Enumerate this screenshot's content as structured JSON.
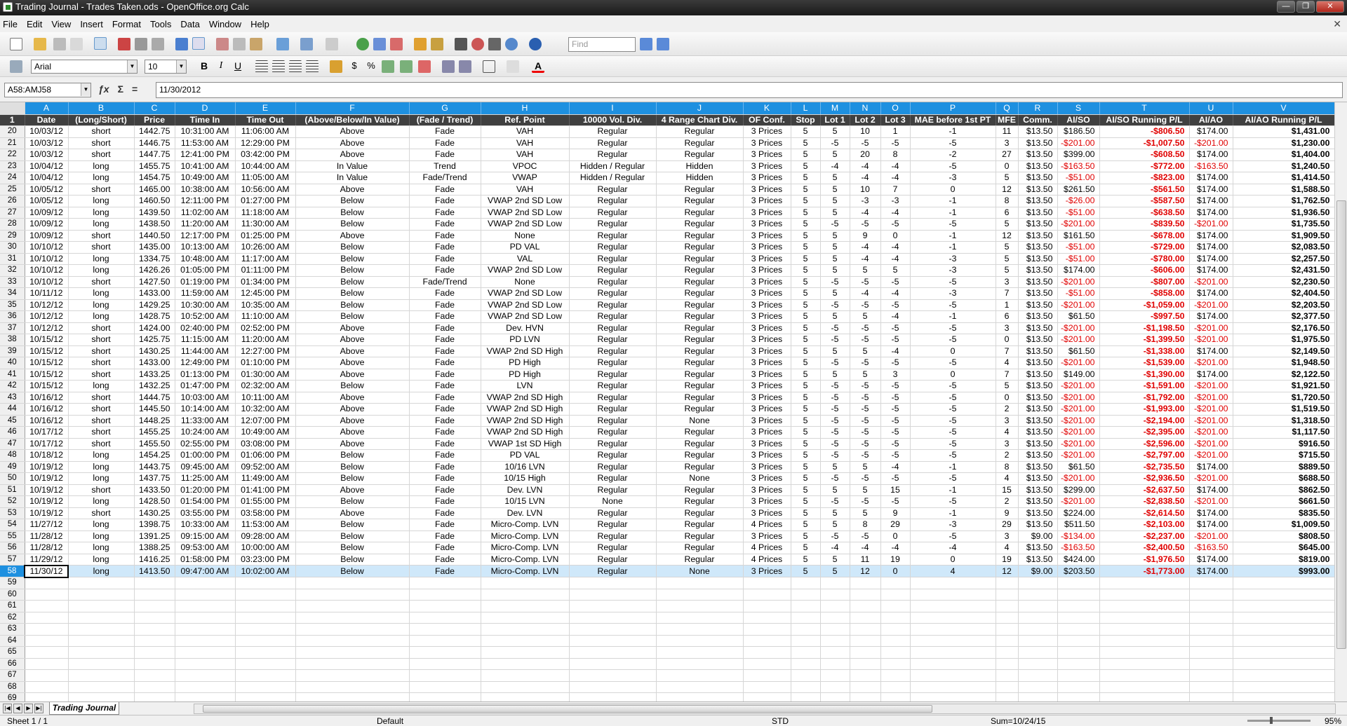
{
  "window": {
    "title": "Trading Journal - Trades Taken.ods - OpenOffice.org Calc"
  },
  "menu": [
    "File",
    "Edit",
    "View",
    "Insert",
    "Format",
    "Tools",
    "Data",
    "Window",
    "Help"
  ],
  "toolbar": {
    "font_name": "Arial",
    "font_size": "10",
    "find_placeholder": "Find"
  },
  "formula_bar": {
    "name_box": "A58:AMJ58",
    "content": "11/30/2012"
  },
  "columns": [
    "A",
    "B",
    "C",
    "D",
    "E",
    "F",
    "G",
    "H",
    "I",
    "J",
    "K",
    "L",
    "M",
    "N",
    "O",
    "P",
    "Q",
    "R",
    "S",
    "T",
    "U",
    "V"
  ],
  "headers": [
    "Date",
    "(Long/Short)",
    "Price",
    "Time In",
    "Time Out",
    "(Above/Below/In Value)",
    "(Fade / Trend)",
    "Ref. Point",
    "10000 Vol. Div.",
    "4 Range Chart Div.",
    "OF Conf.",
    "Stop",
    "Lot 1",
    "Lot 2",
    "Lot 3",
    "MAE before 1st PT",
    "MFE",
    "Comm.",
    "AI/SO",
    "AI/SO Running P/L",
    "AI/AO",
    "AI/AO Running P/L"
  ],
  "rows": [
    [
      "20",
      "10/03/12",
      "short",
      "1442.75",
      "10:31:00 AM",
      "11:06:00 AM",
      "Above",
      "Fade",
      "VAH",
      "Regular",
      "Regular",
      "3 Prices",
      "5",
      "5",
      "10",
      "1",
      "-1",
      "11",
      "$13.50",
      "$186.50",
      "-$806.50",
      "$174.00",
      "$1,431.00"
    ],
    [
      "21",
      "10/03/12",
      "short",
      "1446.75",
      "11:53:00 AM",
      "12:29:00 PM",
      "Above",
      "Fade",
      "VAH",
      "Regular",
      "Regular",
      "3 Prices",
      "5",
      "-5",
      "-5",
      "-5",
      "-5",
      "3",
      "$13.50",
      "-$201.00",
      "-$1,007.50",
      "-$201.00",
      "$1,230.00"
    ],
    [
      "22",
      "10/03/12",
      "short",
      "1447.75",
      "12:41:00 PM",
      "03:42:00 PM",
      "Above",
      "Fade",
      "VAH",
      "Regular",
      "Regular",
      "3 Prices",
      "5",
      "5",
      "20",
      "8",
      "-2",
      "27",
      "$13.50",
      "$399.00",
      "-$608.50",
      "$174.00",
      "$1,404.00"
    ],
    [
      "23",
      "10/04/12",
      "long",
      "1455.75",
      "10:41:00 AM",
      "10:44:00 AM",
      "In Value",
      "Trend",
      "VPOC",
      "Hidden / Regular",
      "Hidden",
      "3 Prices",
      "5",
      "-4",
      "-4",
      "-4",
      "-5",
      "0",
      "$13.50",
      "-$163.50",
      "-$772.00",
      "-$163.50",
      "$1,240.50"
    ],
    [
      "24",
      "10/04/12",
      "long",
      "1454.75",
      "10:49:00 AM",
      "11:05:00 AM",
      "In Value",
      "Fade/Trend",
      "VWAP",
      "Hidden / Regular",
      "Hidden",
      "3 Prices",
      "5",
      "5",
      "-4",
      "-4",
      "-3",
      "5",
      "$13.50",
      "-$51.00",
      "-$823.00",
      "$174.00",
      "$1,414.50"
    ],
    [
      "25",
      "10/05/12",
      "short",
      "1465.00",
      "10:38:00 AM",
      "10:56:00 AM",
      "Above",
      "Fade",
      "VAH",
      "Regular",
      "Regular",
      "3 Prices",
      "5",
      "5",
      "10",
      "7",
      "0",
      "12",
      "$13.50",
      "$261.50",
      "-$561.50",
      "$174.00",
      "$1,588.50"
    ],
    [
      "26",
      "10/05/12",
      "long",
      "1460.50",
      "12:11:00 PM",
      "01:27:00 PM",
      "Below",
      "Fade",
      "VWAP 2nd SD Low",
      "Regular",
      "Regular",
      "3 Prices",
      "5",
      "5",
      "-3",
      "-3",
      "-1",
      "8",
      "$13.50",
      "-$26.00",
      "-$587.50",
      "$174.00",
      "$1,762.50"
    ],
    [
      "27",
      "10/09/12",
      "long",
      "1439.50",
      "11:02:00 AM",
      "11:18:00 AM",
      "Below",
      "Fade",
      "VWAP 2nd SD Low",
      "Regular",
      "Regular",
      "3 Prices",
      "5",
      "5",
      "-4",
      "-4",
      "-1",
      "6",
      "$13.50",
      "-$51.00",
      "-$638.50",
      "$174.00",
      "$1,936.50"
    ],
    [
      "28",
      "10/09/12",
      "long",
      "1438.50",
      "11:20:00 AM",
      "11:30:00 AM",
      "Below",
      "Fade",
      "VWAP 2nd SD Low",
      "Regular",
      "Regular",
      "3 Prices",
      "5",
      "-5",
      "-5",
      "-5",
      "-5",
      "5",
      "$13.50",
      "-$201.00",
      "-$839.50",
      "-$201.00",
      "$1,735.50"
    ],
    [
      "29",
      "10/09/12",
      "short",
      "1440.50",
      "12:17:00 PM",
      "01:25:00 PM",
      "Above",
      "Fade",
      "None",
      "Regular",
      "Regular",
      "3 Prices",
      "5",
      "5",
      "9",
      "0",
      "-1",
      "12",
      "$13.50",
      "$161.50",
      "-$678.00",
      "$174.00",
      "$1,909.50"
    ],
    [
      "30",
      "10/10/12",
      "short",
      "1435.00",
      "10:13:00 AM",
      "10:26:00 AM",
      "Below",
      "Fade",
      "PD VAL",
      "Regular",
      "Regular",
      "3 Prices",
      "5",
      "5",
      "-4",
      "-4",
      "-1",
      "5",
      "$13.50",
      "-$51.00",
      "-$729.00",
      "$174.00",
      "$2,083.50"
    ],
    [
      "31",
      "10/10/12",
      "long",
      "1334.75",
      "10:48:00 AM",
      "11:17:00 AM",
      "Below",
      "Fade",
      "VAL",
      "Regular",
      "Regular",
      "3 Prices",
      "5",
      "5",
      "-4",
      "-4",
      "-3",
      "5",
      "$13.50",
      "-$51.00",
      "-$780.00",
      "$174.00",
      "$2,257.50"
    ],
    [
      "32",
      "10/10/12",
      "long",
      "1426.26",
      "01:05:00 PM",
      "01:11:00 PM",
      "Below",
      "Fade",
      "VWAP 2nd SD Low",
      "Regular",
      "Regular",
      "3 Prices",
      "5",
      "5",
      "5",
      "5",
      "-3",
      "5",
      "$13.50",
      "$174.00",
      "-$606.00",
      "$174.00",
      "$2,431.50"
    ],
    [
      "33",
      "10/10/12",
      "short",
      "1427.50",
      "01:19:00 PM",
      "01:34:00 PM",
      "Below",
      "Fade/Trend",
      "None",
      "Regular",
      "Regular",
      "3 Prices",
      "5",
      "-5",
      "-5",
      "-5",
      "-5",
      "3",
      "$13.50",
      "-$201.00",
      "-$807.00",
      "-$201.00",
      "$2,230.50"
    ],
    [
      "34",
      "10/11/12",
      "long",
      "1433.00",
      "11:59:00 AM",
      "12:45:00 PM",
      "Below",
      "Fade",
      "VWAP 2nd SD Low",
      "Regular",
      "Regular",
      "3 Prices",
      "5",
      "5",
      "-4",
      "-4",
      "-3",
      "7",
      "$13.50",
      "-$51.00",
      "-$858.00",
      "$174.00",
      "$2,404.50"
    ],
    [
      "35",
      "10/12/12",
      "long",
      "1429.25",
      "10:30:00 AM",
      "10:35:00 AM",
      "Below",
      "Fade",
      "VWAP 2nd SD Low",
      "Regular",
      "Regular",
      "3 Prices",
      "5",
      "-5",
      "-5",
      "-5",
      "-5",
      "1",
      "$13.50",
      "-$201.00",
      "-$1,059.00",
      "-$201.00",
      "$2,203.50"
    ],
    [
      "36",
      "10/12/12",
      "long",
      "1428.75",
      "10:52:00 AM",
      "11:10:00 AM",
      "Below",
      "Fade",
      "VWAP 2nd SD Low",
      "Regular",
      "Regular",
      "3 Prices",
      "5",
      "5",
      "5",
      "-4",
      "-1",
      "6",
      "$13.50",
      "$61.50",
      "-$997.50",
      "$174.00",
      "$2,377.50"
    ],
    [
      "37",
      "10/12/12",
      "short",
      "1424.00",
      "02:40:00 PM",
      "02:52:00 PM",
      "Above",
      "Fade",
      "Dev. HVN",
      "Regular",
      "Regular",
      "3 Prices",
      "5",
      "-5",
      "-5",
      "-5",
      "-5",
      "3",
      "$13.50",
      "-$201.00",
      "-$1,198.50",
      "-$201.00",
      "$2,176.50"
    ],
    [
      "38",
      "10/15/12",
      "short",
      "1425.75",
      "11:15:00 AM",
      "11:20:00 AM",
      "Above",
      "Fade",
      "PD LVN",
      "Regular",
      "Regular",
      "3 Prices",
      "5",
      "-5",
      "-5",
      "-5",
      "-5",
      "0",
      "$13.50",
      "-$201.00",
      "-$1,399.50",
      "-$201.00",
      "$1,975.50"
    ],
    [
      "39",
      "10/15/12",
      "short",
      "1430.25",
      "11:44:00 AM",
      "12:27:00 PM",
      "Above",
      "Fade",
      "VWAP 2nd SD High",
      "Regular",
      "Regular",
      "3 Prices",
      "5",
      "5",
      "5",
      "-4",
      "0",
      "7",
      "$13.50",
      "$61.50",
      "-$1,338.00",
      "$174.00",
      "$2,149.50"
    ],
    [
      "40",
      "10/15/12",
      "short",
      "1433.00",
      "12:49:00 PM",
      "01:10:00 PM",
      "Above",
      "Fade",
      "PD High",
      "Regular",
      "Regular",
      "3 Prices",
      "5",
      "-5",
      "-5",
      "-5",
      "-5",
      "4",
      "$13.50",
      "-$201.00",
      "-$1,539.00",
      "-$201.00",
      "$1,948.50"
    ],
    [
      "41",
      "10/15/12",
      "short",
      "1433.25",
      "01:13:00 PM",
      "01:30:00 AM",
      "Above",
      "Fade",
      "PD High",
      "Regular",
      "Regular",
      "3 Prices",
      "5",
      "5",
      "5",
      "3",
      "0",
      "7",
      "$13.50",
      "$149.00",
      "-$1,390.00",
      "$174.00",
      "$2,122.50"
    ],
    [
      "42",
      "10/15/12",
      "long",
      "1432.25",
      "01:47:00 PM",
      "02:32:00 AM",
      "Below",
      "Fade",
      "LVN",
      "Regular",
      "Regular",
      "3 Prices",
      "5",
      "-5",
      "-5",
      "-5",
      "-5",
      "5",
      "$13.50",
      "-$201.00",
      "-$1,591.00",
      "-$201.00",
      "$1,921.50"
    ],
    [
      "43",
      "10/16/12",
      "short",
      "1444.75",
      "10:03:00 AM",
      "10:11:00 AM",
      "Above",
      "Fade",
      "VWAP 2nd SD High",
      "Regular",
      "Regular",
      "3 Prices",
      "5",
      "-5",
      "-5",
      "-5",
      "-5",
      "0",
      "$13.50",
      "-$201.00",
      "-$1,792.00",
      "-$201.00",
      "$1,720.50"
    ],
    [
      "44",
      "10/16/12",
      "short",
      "1445.50",
      "10:14:00 AM",
      "10:32:00 AM",
      "Above",
      "Fade",
      "VWAP 2nd SD High",
      "Regular",
      "Regular",
      "3 Prices",
      "5",
      "-5",
      "-5",
      "-5",
      "-5",
      "2",
      "$13.50",
      "-$201.00",
      "-$1,993.00",
      "-$201.00",
      "$1,519.50"
    ],
    [
      "45",
      "10/16/12",
      "short",
      "1448.25",
      "11:33:00 AM",
      "12:07:00 PM",
      "Above",
      "Fade",
      "VWAP 2nd SD High",
      "Regular",
      "None",
      "3 Prices",
      "5",
      "-5",
      "-5",
      "-5",
      "-5",
      "3",
      "$13.50",
      "-$201.00",
      "-$2,194.00",
      "-$201.00",
      "$1,318.50"
    ],
    [
      "46",
      "10/17/12",
      "short",
      "1455.25",
      "10:24:00 AM",
      "10:49:00 AM",
      "Above",
      "Fade",
      "VWAP 2nd SD High",
      "Regular",
      "Regular",
      "3 Prices",
      "5",
      "-5",
      "-5",
      "-5",
      "-5",
      "4",
      "$13.50",
      "-$201.00",
      "-$2,395.00",
      "-$201.00",
      "$1,117.50"
    ],
    [
      "47",
      "10/17/12",
      "short",
      "1455.50",
      "02:55:00 PM",
      "03:08:00 PM",
      "Above",
      "Fade",
      "VWAP 1st SD High",
      "Regular",
      "Regular",
      "3 Prices",
      "5",
      "-5",
      "-5",
      "-5",
      "-5",
      "3",
      "$13.50",
      "-$201.00",
      "-$2,596.00",
      "-$201.00",
      "$916.50"
    ],
    [
      "48",
      "10/18/12",
      "long",
      "1454.25",
      "01:00:00 PM",
      "01:06:00 PM",
      "Below",
      "Fade",
      "PD VAL",
      "Regular",
      "Regular",
      "3 Prices",
      "5",
      "-5",
      "-5",
      "-5",
      "-5",
      "2",
      "$13.50",
      "-$201.00",
      "-$2,797.00",
      "-$201.00",
      "$715.50"
    ],
    [
      "49",
      "10/19/12",
      "long",
      "1443.75",
      "09:45:00 AM",
      "09:52:00 AM",
      "Below",
      "Fade",
      "10/16 LVN",
      "Regular",
      "Regular",
      "3 Prices",
      "5",
      "5",
      "5",
      "-4",
      "-1",
      "8",
      "$13.50",
      "$61.50",
      "-$2,735.50",
      "$174.00",
      "$889.50"
    ],
    [
      "50",
      "10/19/12",
      "long",
      "1437.75",
      "11:25:00 AM",
      "11:49:00 AM",
      "Below",
      "Fade",
      "10/15 High",
      "Regular",
      "None",
      "3 Prices",
      "5",
      "-5",
      "-5",
      "-5",
      "-5",
      "4",
      "$13.50",
      "-$201.00",
      "-$2,936.50",
      "-$201.00",
      "$688.50"
    ],
    [
      "51",
      "10/19/12",
      "short",
      "1433.50",
      "01:20:00 PM",
      "01:41:00 PM",
      "Above",
      "Fade",
      "Dev. LVN",
      "Regular",
      "Regular",
      "3 Prices",
      "5",
      "5",
      "5",
      "15",
      "-1",
      "15",
      "$13.50",
      "$299.00",
      "-$2,637.50",
      "$174.00",
      "$862.50"
    ],
    [
      "52",
      "10/19/12",
      "long",
      "1428.50",
      "01:54:00 PM",
      "01:55:00 PM",
      "Below",
      "Fade",
      "10/15 LVN",
      "None",
      "Regular",
      "3 Prices",
      "5",
      "-5",
      "-5",
      "-5",
      "-5",
      "2",
      "$13.50",
      "-$201.00",
      "-$2,838.50",
      "-$201.00",
      "$661.50"
    ],
    [
      "53",
      "10/19/12",
      "short",
      "1430.25",
      "03:55:00 PM",
      "03:58:00 PM",
      "Above",
      "Fade",
      "Dev. LVN",
      "Regular",
      "Regular",
      "3 Prices",
      "5",
      "5",
      "5",
      "9",
      "-1",
      "9",
      "$13.50",
      "$224.00",
      "-$2,614.50",
      "$174.00",
      "$835.50"
    ],
    [
      "54",
      "11/27/12",
      "long",
      "1398.75",
      "10:33:00 AM",
      "11:53:00 AM",
      "Below",
      "Fade",
      "Micro-Comp. LVN",
      "Regular",
      "Regular",
      "4 Prices",
      "5",
      "5",
      "8",
      "29",
      "-3",
      "29",
      "$13.50",
      "$511.50",
      "-$2,103.00",
      "$174.00",
      "$1,009.50"
    ],
    [
      "55",
      "11/28/12",
      "long",
      "1391.25",
      "09:15:00 AM",
      "09:28:00 AM",
      "Below",
      "Fade",
      "Micro-Comp. LVN",
      "Regular",
      "Regular",
      "3 Prices",
      "5",
      "-5",
      "-5",
      "0",
      "-5",
      "3",
      "$9.00",
      "-$134.00",
      "-$2,237.00",
      "-$201.00",
      "$808.50"
    ],
    [
      "56",
      "11/28/12",
      "long",
      "1388.25",
      "09:53:00 AM",
      "10:00:00 AM",
      "Below",
      "Fade",
      "Micro-Comp. LVN",
      "Regular",
      "Regular",
      "4 Prices",
      "5",
      "-4",
      "-4",
      "-4",
      "-4",
      "4",
      "$13.50",
      "-$163.50",
      "-$2,400.50",
      "-$163.50",
      "$645.00"
    ],
    [
      "57",
      "11/29/12",
      "long",
      "1416.25",
      "01:58:00 PM",
      "03:23:00 PM",
      "Below",
      "Fade",
      "Micro-Comp. LVN",
      "Regular",
      "Regular",
      "4 Prices",
      "5",
      "5",
      "11",
      "19",
      "0",
      "19",
      "$13.50",
      "$424.00",
      "-$1,976.50",
      "$174.00",
      "$819.00"
    ],
    [
      "58",
      "11/30/12",
      "long",
      "1413.50",
      "09:47:00 AM",
      "10:02:00 AM",
      "Below",
      "Fade",
      "Micro-Comp. LVN",
      "Regular",
      "None",
      "3 Prices",
      "5",
      "5",
      "12",
      "0",
      "4",
      "12",
      "$9.00",
      "$203.50",
      "-$1,773.00",
      "$174.00",
      "$993.00"
    ]
  ],
  "empty_rows": [
    "59",
    "60",
    "61",
    "62",
    "63",
    "64",
    "65",
    "66",
    "67",
    "68",
    "69"
  ],
  "selected_row": "58",
  "sheet_tab": "Trading Journal",
  "status": {
    "sheet": "Sheet 1 / 1",
    "style": "Default",
    "mode": "STD",
    "sum": "Sum=10/24/15",
    "zoom": "95%"
  },
  "colors": {
    "header_blue": "#1e90e0",
    "header_dark": "#404040",
    "negative": "#e00000"
  }
}
